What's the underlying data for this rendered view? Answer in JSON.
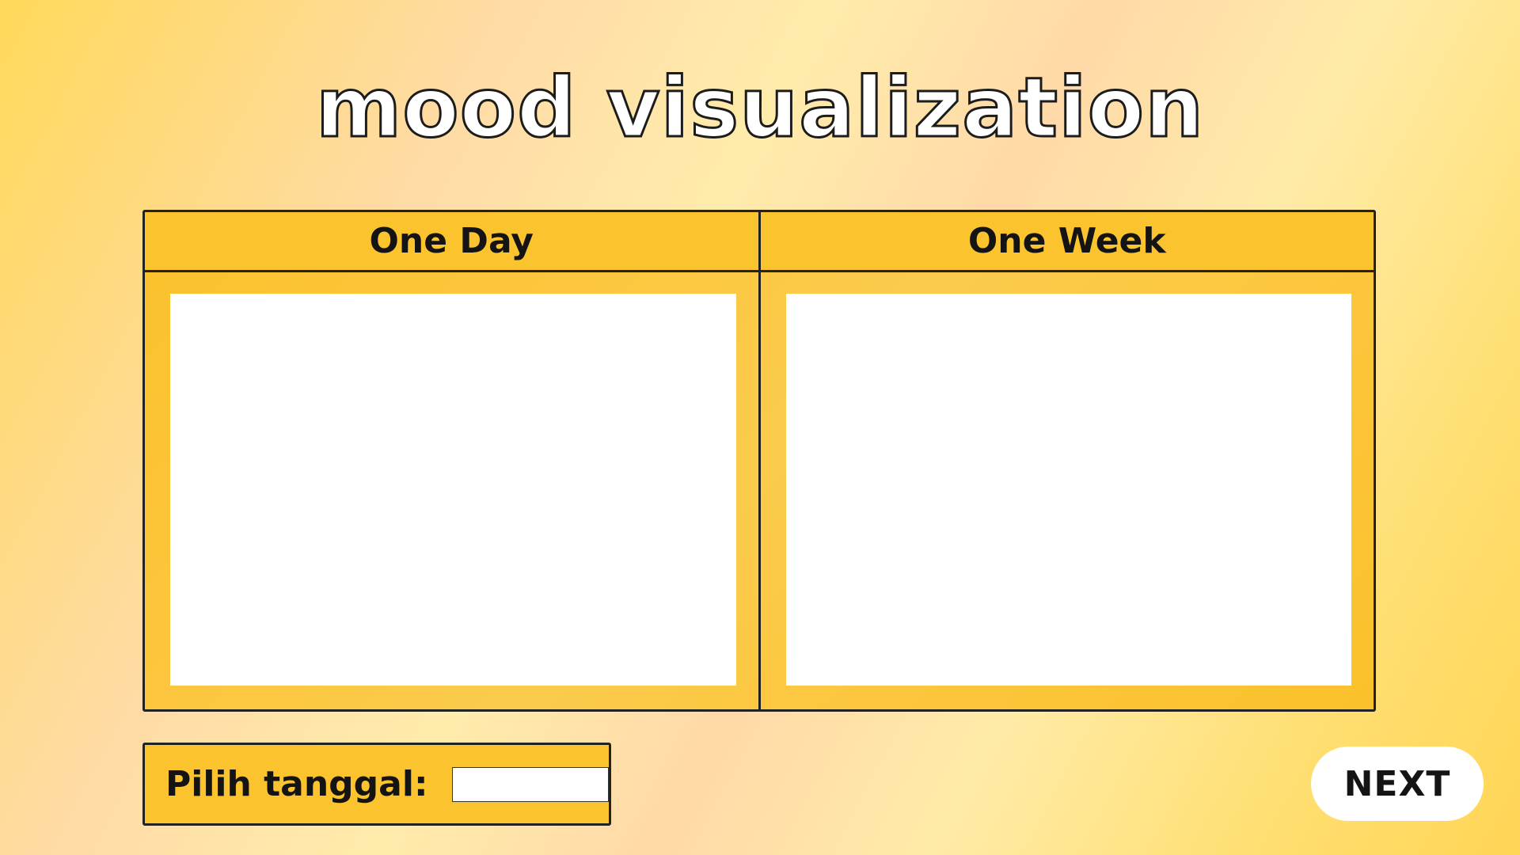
{
  "page": {
    "title": "mood visualization"
  },
  "panels": [
    {
      "label": "One Day"
    },
    {
      "label": "One Week"
    }
  ],
  "date_picker": {
    "label": "Pilih tanggal:",
    "value": ""
  },
  "next_button": {
    "label": "NEXT"
  },
  "colors": {
    "panel_fill": "#FBC42F",
    "border": "#222222",
    "button_fill": "#FFFFFF",
    "title_fill": "#FFFFFF"
  }
}
